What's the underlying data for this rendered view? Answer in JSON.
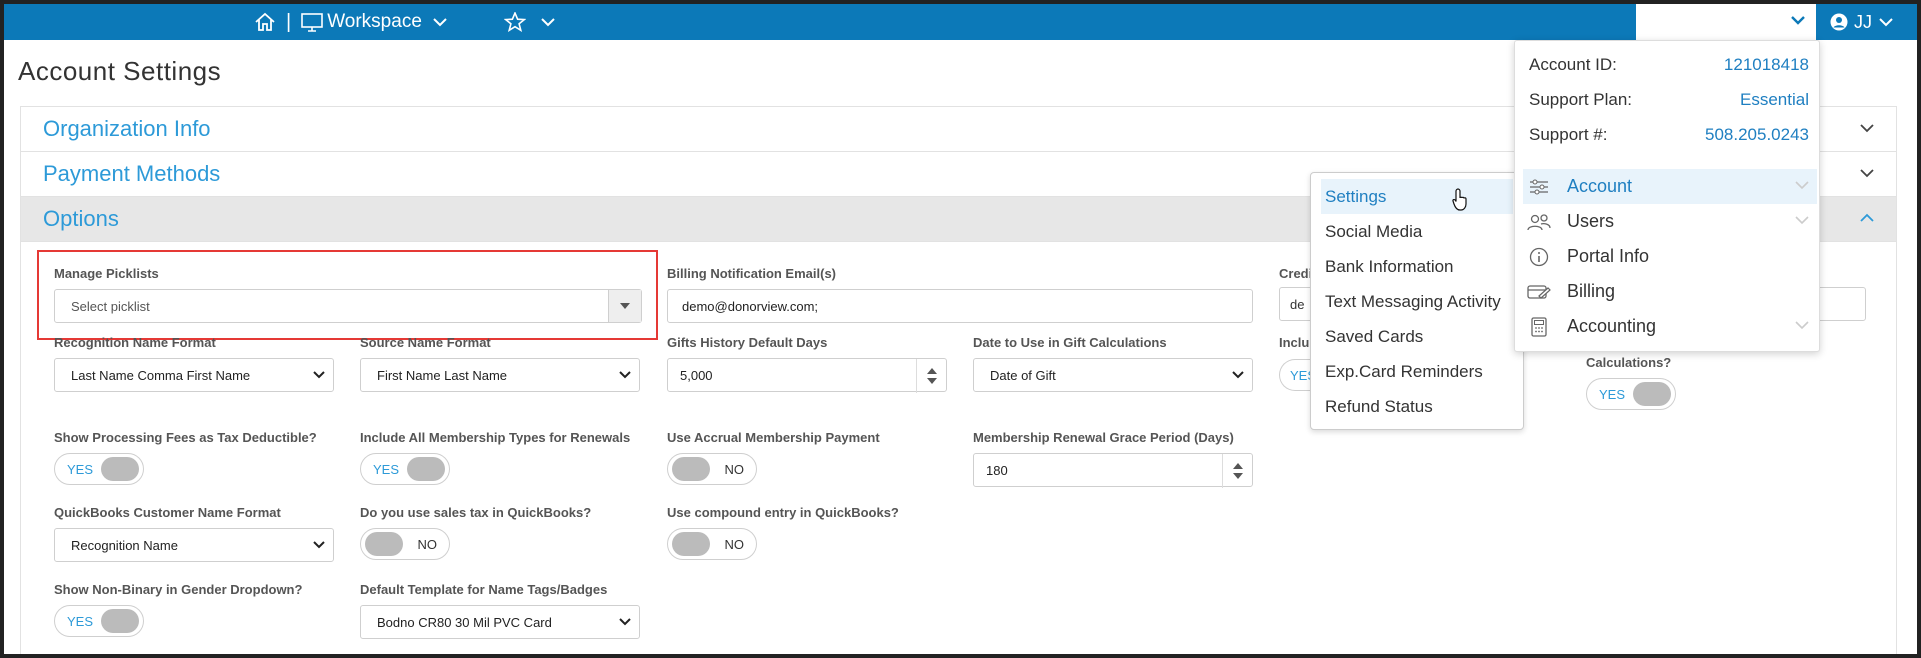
{
  "topbar": {
    "workspace_label": "Workspace",
    "separator": "|",
    "user_initials": "JJ"
  },
  "page": {
    "title": "Account Settings"
  },
  "accordion": {
    "sections": [
      {
        "label": "Organization Info"
      },
      {
        "label": "Payment Methods"
      },
      {
        "label": "Options"
      }
    ]
  },
  "options": {
    "manage_picklists": {
      "label": "Manage Picklists",
      "placeholder": "Select picklist"
    },
    "billing_email": {
      "label": "Billing Notification Email(s)",
      "value": "demo@donorview.com;"
    },
    "credit_label_partial": "Credi",
    "credit_value_partial": "de",
    "include_label_partial": "Inclu",
    "partial_yes": "YES",
    "calculations_label": "Calculations?",
    "calculations_toggle": "YES",
    "recognition_name_format": {
      "label": "Recognition Name Format",
      "value": "Last Name Comma First Name"
    },
    "source_name_format": {
      "label": "Source Name Format",
      "value": "First Name Last Name"
    },
    "gifts_history_days": {
      "label": "Gifts History Default Days",
      "value": "5,000"
    },
    "gift_calc_date": {
      "label": "Date to Use in Gift Calculations",
      "value": "Date of Gift"
    },
    "processing_fees": {
      "label": "Show Processing Fees as Tax Deductible?",
      "toggle": "YES"
    },
    "all_membership_types": {
      "label": "Include All Membership Types for Renewals",
      "toggle": "YES"
    },
    "accrual_membership": {
      "label": "Use Accrual Membership Payment",
      "toggle": "NO"
    },
    "renewal_grace": {
      "label": "Membership Renewal Grace Period (Days)",
      "value": "180"
    },
    "qb_customer_name": {
      "label": "QuickBooks Customer Name Format",
      "value": "Recognition Name"
    },
    "qb_sales_tax": {
      "label": "Do you use sales tax in QuickBooks?",
      "toggle": "NO"
    },
    "qb_compound": {
      "label": "Use compound entry in QuickBooks?",
      "toggle": "NO"
    },
    "non_binary": {
      "label": "Show Non-Binary in Gender Dropdown?",
      "toggle": "YES"
    },
    "name_tag_template": {
      "label": "Default Template for Name Tags/Badges",
      "value": "Bodno CR80 30 Mil PVC Card"
    }
  },
  "settings_submenu": {
    "items": [
      {
        "label": "Settings"
      },
      {
        "label": "Social Media"
      },
      {
        "label": "Bank Information"
      },
      {
        "label": "Text Messaging Activity"
      },
      {
        "label": "Saved Cards"
      },
      {
        "label": "Exp.Card Reminders"
      },
      {
        "label": "Refund Status"
      }
    ]
  },
  "account_menu": {
    "account_id": {
      "label": "Account ID:",
      "value": "121018418"
    },
    "support_plan": {
      "label": "Support Plan:",
      "value": "Essential"
    },
    "support_phone": {
      "label": "Support #:",
      "value": "508.205.0243"
    },
    "items": [
      {
        "label": "Account",
        "icon": "sliders-icon"
      },
      {
        "label": "Users",
        "icon": "users-icon"
      },
      {
        "label": "Portal Info",
        "icon": "info-icon"
      },
      {
        "label": "Billing",
        "icon": "billing-icon"
      },
      {
        "label": "Accounting",
        "icon": "calculator-icon"
      }
    ]
  },
  "colors": {
    "topbar": "#0c79b8",
    "accent": "#2d9ad8",
    "highlight": "#e53935"
  }
}
